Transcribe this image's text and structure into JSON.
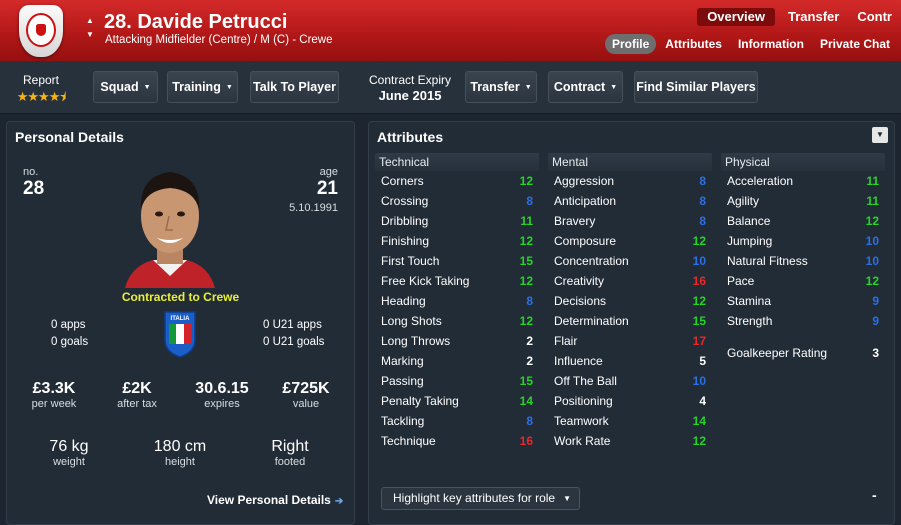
{
  "header": {
    "player_name": "28. Davide Petrucci",
    "position": "Attacking Midfielder (Centre) / M (C) - Crewe",
    "top_tabs": [
      "Overview",
      "Transfer",
      "Contr"
    ],
    "sub_tabs": [
      "Profile",
      "Attributes",
      "Information",
      "Private Chat"
    ],
    "active_sub_tab": "Profile",
    "accent_color": "#c21d1d"
  },
  "toolbar": {
    "report_label": "Report",
    "stars": "★★★★⯨",
    "squad": "Squad",
    "training": "Training",
    "talk": "Talk To Player",
    "contract_expiry_label": "Contract Expiry",
    "contract_expiry_value": "June 2015",
    "transfer": "Transfer",
    "contract": "Contract",
    "find_similar": "Find Similar Players"
  },
  "personal": {
    "title": "Personal Details",
    "no_label": "no.",
    "no_value": "28",
    "age_label": "age",
    "age_value": "21",
    "dob": "5.10.1991",
    "contracted": "Contracted to Crewe",
    "flag_label": "ITALIA",
    "apps": "0 apps",
    "goals": "0 goals",
    "u21_apps": "0 U21 apps",
    "u21_goals": "0 U21 goals",
    "wage": "£3.3K",
    "wage_label": "per week",
    "after_tax": "£2K",
    "after_tax_label": "after tax",
    "expires": "30.6.15",
    "expires_label": "expires",
    "value": "£725K",
    "value_label": "value",
    "weight": "76 kg",
    "weight_label": "weight",
    "height": "180 cm",
    "height_label": "height",
    "foot": "Right",
    "foot_label": "footed",
    "view_link": "View Personal Details"
  },
  "attributes": {
    "title": "Attributes",
    "colors": {
      "green": "#25d425",
      "blue": "#2a6fe8",
      "red": "#e8292a",
      "white": "#ffffff"
    },
    "columns": [
      {
        "heading": "Technical",
        "rows": [
          {
            "name": "Corners",
            "value": "12",
            "color": "green"
          },
          {
            "name": "Crossing",
            "value": "8",
            "color": "blue"
          },
          {
            "name": "Dribbling",
            "value": "11",
            "color": "green"
          },
          {
            "name": "Finishing",
            "value": "12",
            "color": "green"
          },
          {
            "name": "First Touch",
            "value": "15",
            "color": "green"
          },
          {
            "name": "Free Kick Taking",
            "value": "12",
            "color": "green"
          },
          {
            "name": "Heading",
            "value": "8",
            "color": "blue"
          },
          {
            "name": "Long Shots",
            "value": "12",
            "color": "green"
          },
          {
            "name": "Long Throws",
            "value": "2",
            "color": "white"
          },
          {
            "name": "Marking",
            "value": "2",
            "color": "white"
          },
          {
            "name": "Passing",
            "value": "15",
            "color": "green"
          },
          {
            "name": "Penalty Taking",
            "value": "14",
            "color": "green"
          },
          {
            "name": "Tackling",
            "value": "8",
            "color": "blue"
          },
          {
            "name": "Technique",
            "value": "16",
            "color": "red"
          }
        ]
      },
      {
        "heading": "Mental",
        "rows": [
          {
            "name": "Aggression",
            "value": "8",
            "color": "blue"
          },
          {
            "name": "Anticipation",
            "value": "8",
            "color": "blue"
          },
          {
            "name": "Bravery",
            "value": "8",
            "color": "blue"
          },
          {
            "name": "Composure",
            "value": "12",
            "color": "green"
          },
          {
            "name": "Concentration",
            "value": "10",
            "color": "blue"
          },
          {
            "name": "Creativity",
            "value": "16",
            "color": "red"
          },
          {
            "name": "Decisions",
            "value": "12",
            "color": "green"
          },
          {
            "name": "Determination",
            "value": "15",
            "color": "green"
          },
          {
            "name": "Flair",
            "value": "17",
            "color": "red"
          },
          {
            "name": "Influence",
            "value": "5",
            "color": "white"
          },
          {
            "name": "Off The Ball",
            "value": "10",
            "color": "blue"
          },
          {
            "name": "Positioning",
            "value": "4",
            "color": "white"
          },
          {
            "name": "Teamwork",
            "value": "14",
            "color": "green"
          },
          {
            "name": "Work Rate",
            "value": "12",
            "color": "green"
          }
        ]
      },
      {
        "heading": "Physical",
        "rows": [
          {
            "name": "Acceleration",
            "value": "11",
            "color": "green"
          },
          {
            "name": "Agility",
            "value": "11",
            "color": "green"
          },
          {
            "name": "Balance",
            "value": "12",
            "color": "green"
          },
          {
            "name": "Jumping",
            "value": "10",
            "color": "blue"
          },
          {
            "name": "Natural Fitness",
            "value": "10",
            "color": "blue"
          },
          {
            "name": "Pace",
            "value": "12",
            "color": "green"
          },
          {
            "name": "Stamina",
            "value": "9",
            "color": "blue"
          },
          {
            "name": "Strength",
            "value": "9",
            "color": "blue"
          }
        ]
      }
    ],
    "gk_label": "Goalkeeper Rating",
    "gk_value": "3",
    "highlight_select": "Highlight key attributes for role",
    "minus": "-"
  }
}
